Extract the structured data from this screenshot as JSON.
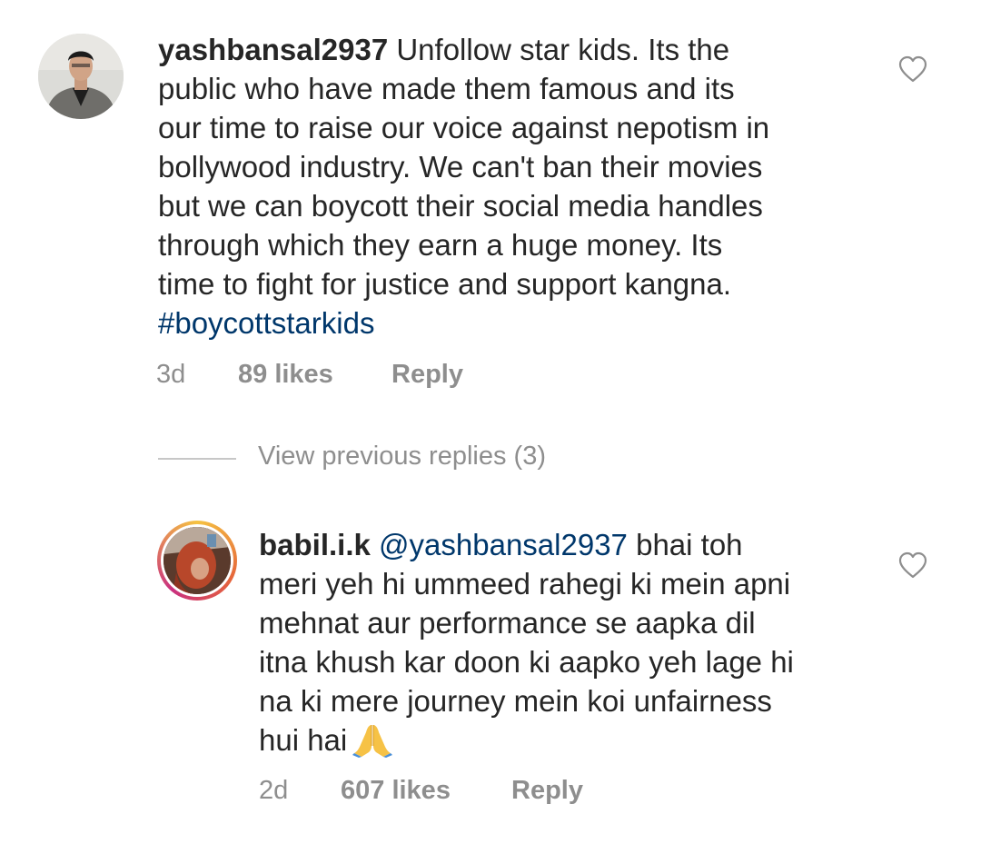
{
  "comments": [
    {
      "username": "yashbansal2937",
      "text_lines": [
        " Unfollow star kids. Its the",
        "public who have made them famous and its",
        "our time to raise our voice against nepotism in",
        "bollywood industry. We can't ban their movies",
        "but we can boycott their social media handles",
        "through which they earn a huge money. Its",
        "time to fight for justice and support kangna."
      ],
      "hashtag": "#boycottstarkids",
      "time": "3d",
      "likes": "89 likes",
      "reply_label": "Reply",
      "heart_icon": "heart-outline-icon"
    },
    {
      "username": "babil.i.k",
      "mention": "@yashbansal2937",
      "text_lines": [
        " bhai toh",
        "meri yeh hi ummeed rahegi ki mein apni",
        "mehnat aur performance se aapka dil",
        "itna khush kar doon ki aapko yeh lage hi",
        "na ki mere journey mein koi unfairness",
        "hui hai"
      ],
      "emoji": "folded-hands-emoji",
      "time": "2d",
      "likes": "607 likes",
      "reply_label": "Reply",
      "heart_icon": "heart-outline-icon"
    }
  ],
  "view_replies": {
    "label": "View previous replies (3)"
  },
  "colors": {
    "text": "#262626",
    "secondary": "#8e8e8e",
    "link": "#00376b",
    "divider": "#c7c7c7"
  }
}
